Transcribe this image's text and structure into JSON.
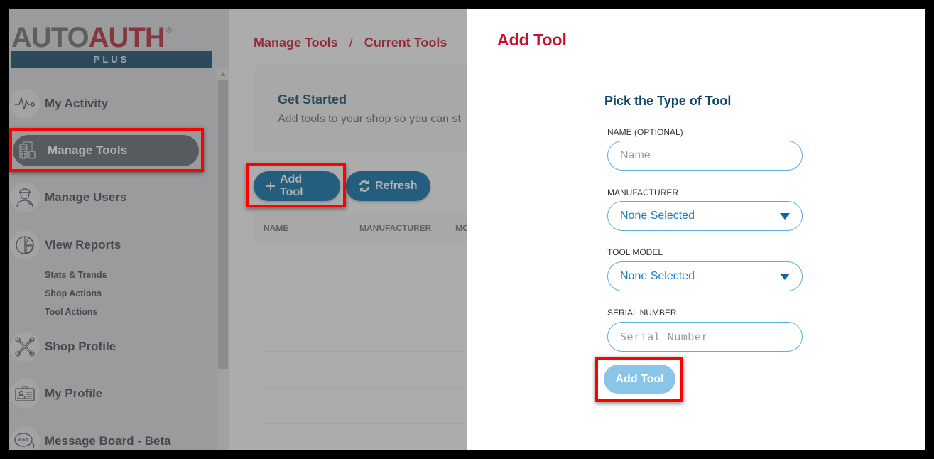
{
  "brand": {
    "auto": "AUTO",
    "auth": "AUTH",
    "registered": "®",
    "tier": "PLUS"
  },
  "sidebar": {
    "items": [
      {
        "label": "My Activity",
        "icon": "activity-pulse-icon"
      },
      {
        "label": "Manage Tools",
        "icon": "scan-tool-icon",
        "active": true
      },
      {
        "label": "Manage Users",
        "icon": "mechanic-user-icon"
      },
      {
        "label": "View Reports",
        "icon": "pie-chart-icon"
      },
      {
        "label": "Shop Profile",
        "icon": "wrenches-icon"
      },
      {
        "label": "My Profile",
        "icon": "id-badge-icon"
      },
      {
        "label": "Message Board - Beta",
        "icon": "chat-bubbles-icon"
      }
    ],
    "report_subitems": [
      "Stats & Trends",
      "Shop Actions",
      "Tool Actions"
    ]
  },
  "main": {
    "breadcrumb": {
      "first": "Manage Tools",
      "separator": "/",
      "second": "Current Tools"
    },
    "get_started": {
      "title": "Get Started",
      "text": "Add tools to your shop so you can st"
    },
    "buttons": {
      "add_tool": "Add Tool",
      "refresh": "Refresh"
    },
    "table": {
      "columns": [
        "NAME",
        "MANUFACTURER",
        "MO"
      ],
      "rows": []
    }
  },
  "dialog": {
    "title": "Add Tool",
    "subtitle": "Pick the Type of Tool",
    "fields": {
      "name": {
        "label": "NAME (OPTIONAL)",
        "placeholder": "Name",
        "value": ""
      },
      "manufacturer": {
        "label": "MANUFACTURER",
        "selected": "None Selected"
      },
      "tool_model": {
        "label": "TOOL MODEL",
        "selected": "None Selected"
      },
      "serial_number": {
        "label": "SERIAL NUMBER",
        "placeholder": "Serial Number",
        "value": ""
      }
    },
    "submit_label": "Add Tool"
  },
  "colors": {
    "brand_red": "#c8102e",
    "brand_navy": "#0f4566",
    "primary_button": "#006ba6",
    "disabled_button": "#88c5e8",
    "highlight": "#ff0000"
  }
}
